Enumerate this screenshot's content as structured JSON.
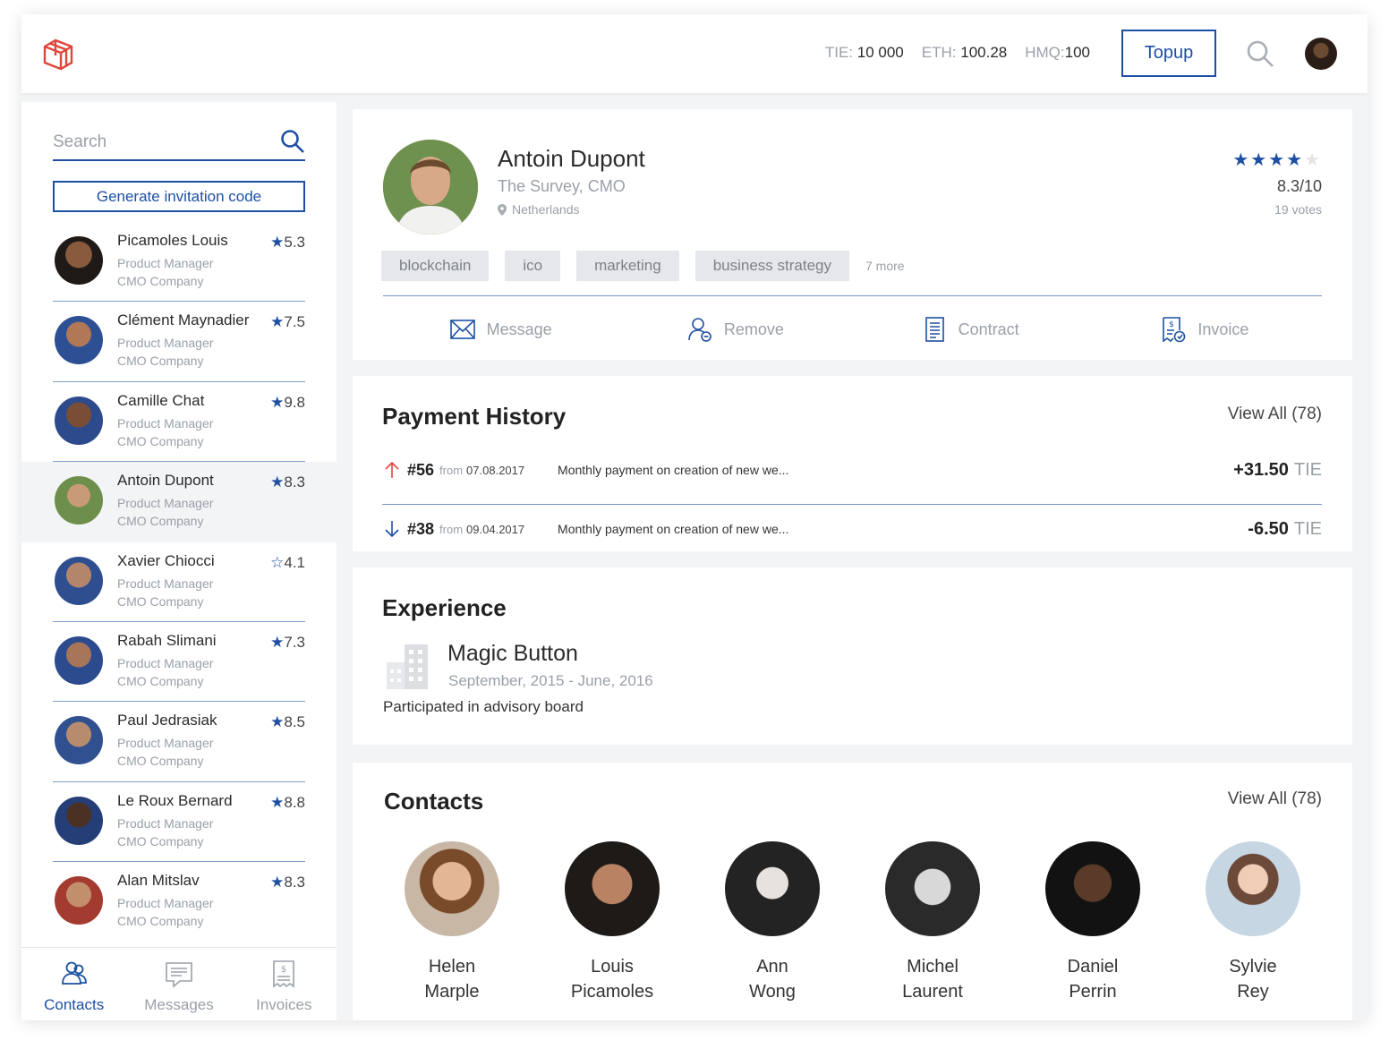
{
  "header": {
    "balances": [
      {
        "label": "TIE:",
        "value": "10 000"
      },
      {
        "label": "ETH:",
        "value": "100.28"
      },
      {
        "label": "HMQ:",
        "value": "100"
      }
    ],
    "topup_label": "Topup"
  },
  "sidebar": {
    "search_placeholder": "Search",
    "invite_label": "Generate invitation code",
    "contacts": [
      {
        "name": "Picamoles Louis",
        "rating": "5.3",
        "title": "Product Manager",
        "company": "CMO Company",
        "star": "★"
      },
      {
        "name": "Clément Maynadier",
        "rating": "7.5",
        "title": "Product Manager",
        "company": "CMO Company",
        "star": "★"
      },
      {
        "name": "Camille Chat",
        "rating": "9.8",
        "title": "Product Manager",
        "company": "CMO Company",
        "star": "★"
      },
      {
        "name": "Antoin Dupont",
        "rating": "8.3",
        "title": "Product Manager",
        "company": "CMO Company",
        "star": "★"
      },
      {
        "name": "Xavier Chiocci",
        "rating": "4.1",
        "title": "Product Manager",
        "company": "CMO Company",
        "star": "☆"
      },
      {
        "name": "Rabah Slimani",
        "rating": "7.3",
        "title": "Product Manager",
        "company": "CMO Company",
        "star": "★"
      },
      {
        "name": "Paul Jedrasiak",
        "rating": "8.5",
        "title": "Product Manager",
        "company": "CMO Company",
        "star": "★"
      },
      {
        "name": "Le Roux Bernard",
        "rating": "8.8",
        "title": "Product Manager",
        "company": "CMO Company",
        "star": "★"
      },
      {
        "name": "Alan Mitslav",
        "rating": "8.3",
        "title": "Product Manager",
        "company": "CMO Company",
        "star": "★"
      }
    ],
    "nav": [
      "Contacts",
      "Messages",
      "Invoices"
    ]
  },
  "profile": {
    "name": "Antoin Dupont",
    "role": "The Survey, CMO",
    "location": "Netherlands",
    "rating_stars": 4,
    "rating_max_stars": 5,
    "score": "8.3/10",
    "votes": "19 votes",
    "tags": [
      "blockchain",
      "ico",
      "marketing",
      "business strategy"
    ],
    "more_tags": "7 more",
    "actions": [
      "Message",
      "Remove",
      "Contract",
      "Invoice"
    ]
  },
  "payments": {
    "title": "Payment History",
    "view_all": "View All (78)",
    "rows": [
      {
        "direction": "up",
        "id": "#56",
        "from_label": "from",
        "date": "07.08.2017",
        "desc": "Monthly payment on creation of new we...",
        "amount": "+31.50",
        "currency": "TIE"
      },
      {
        "direction": "down",
        "id": "#38",
        "from_label": "from",
        "date": "09.04.2017",
        "desc": "Monthly payment on creation of new we...",
        "amount": "-6.50",
        "currency": "TIE"
      }
    ]
  },
  "experience": {
    "title": "Experience",
    "company": "Magic Button",
    "dates": "September, 2015  - June, 2016",
    "desc": "Participated in advisory board"
  },
  "contacts": {
    "title": "Contacts",
    "view_all": "View All (78)",
    "people": [
      {
        "first": "Helen",
        "last": "Marple"
      },
      {
        "first": "Louis",
        "last": "Picamoles"
      },
      {
        "first": "Ann",
        "last": "Wong"
      },
      {
        "first": "Michel",
        "last": "Laurent"
      },
      {
        "first": "Daniel",
        "last": "Perrin"
      },
      {
        "first": "Sylvie",
        "last": "Rey"
      }
    ]
  },
  "colors": {
    "accent": "#1d4fa3",
    "muted": "#9aa0a8",
    "arrow_up": "#e0453a"
  }
}
